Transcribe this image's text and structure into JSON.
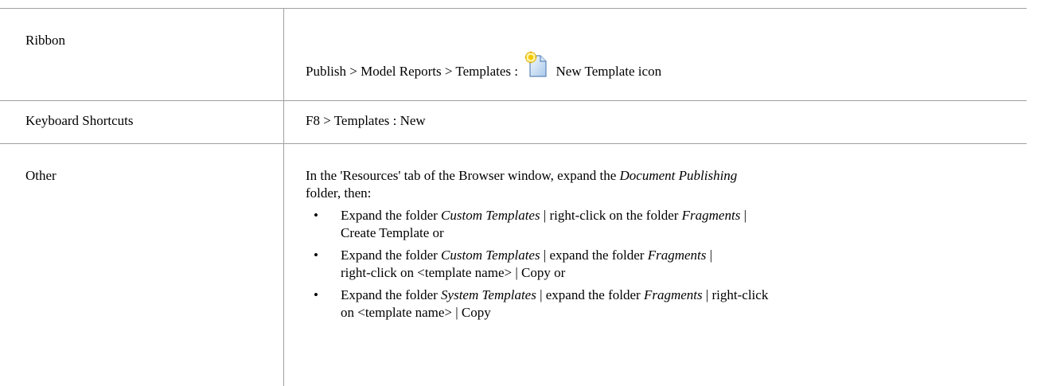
{
  "rows": {
    "ribbon": {
      "label": "Ribbon",
      "path": "Publish > Model Reports > Templates :",
      "icon": "new-template-icon",
      "icon_label": "New Template icon"
    },
    "keyboard": {
      "label": "Keyboard Shortcuts",
      "value": "F8 > Templates : New"
    },
    "other": {
      "label": "Other",
      "intro_a": "In the 'Resources' tab of the Browser window, expand the ",
      "intro_b": "Document Publishing",
      "intro_c": "folder, then:",
      "items": [
        {
          "bullet": "•",
          "p1": "Expand the folder ",
          "i1": "Custom Templates",
          "p2": " | right-click on the folder ",
          "i2": "Fragments",
          "p3": " |",
          "p4": "Create Template or"
        },
        {
          "bullet": "•",
          "p1": "Expand the folder ",
          "i1": "Custom Templates",
          "p2": " | expand the folder ",
          "i2": "Fragments",
          "p3": " |",
          "p4": "right-click on <template name> | Copy or"
        },
        {
          "bullet": "•",
          "p1": "Expand the folder ",
          "i1": "System Templates",
          "p2": " | expand the folder ",
          "i2": "Fragments",
          "p3": " | right-click",
          "p4": "on <template name> | Copy"
        }
      ]
    }
  },
  "colors": {
    "border": "#a0a0a0",
    "text": "#000000"
  }
}
